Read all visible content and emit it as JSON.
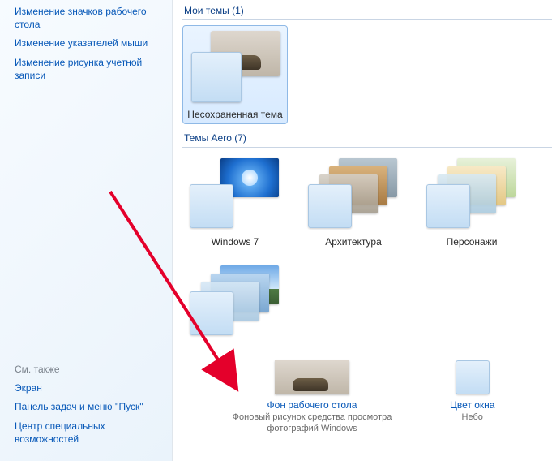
{
  "sidebar": {
    "top_links": [
      "Изменение значков рабочего стола",
      "Изменение указателей мыши",
      "Изменение рисунка учетной записи"
    ],
    "see_also_title": "См. также",
    "see_also_links": [
      "Экран",
      "Панель задач и меню ''Пуск''",
      "Центр специальных возможностей"
    ]
  },
  "groups": {
    "my_themes": {
      "title": "Мои темы (1)",
      "items": [
        {
          "label": "Несохраненная тема",
          "selected": true
        }
      ]
    },
    "aero": {
      "title": "Темы Aero (7)",
      "items": [
        {
          "label": "Windows 7"
        },
        {
          "label": "Архитектура"
        },
        {
          "label": "Персонажи"
        },
        {
          "label": ""
        }
      ]
    }
  },
  "bottom": {
    "bg_label": "Фон рабочего стола",
    "bg_sub": "Фоновый рисунок средства просмотра фотографий Windows",
    "color_label": "Цвет окна",
    "color_sub": "Небо"
  }
}
